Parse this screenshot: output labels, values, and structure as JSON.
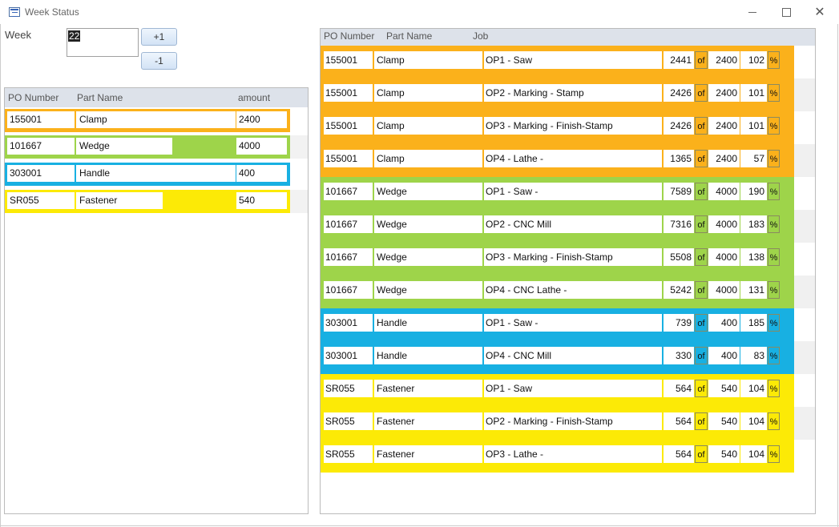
{
  "window": {
    "title": "Week Status"
  },
  "colors": {
    "orange": "#fbb11b",
    "green": "#9ed44a",
    "blue": "#18b0e2",
    "yellow": "#fcea06"
  },
  "week": {
    "label": "Week",
    "value": "22",
    "plus_label": "+1",
    "minus_label": "-1"
  },
  "left_table": {
    "headers": {
      "po": "PO Number",
      "part": "Part Name",
      "amount": "amount"
    },
    "rows": [
      {
        "po": "155001",
        "part": "Clamp",
        "amount": "2400",
        "color": "orange"
      },
      {
        "po": "101667",
        "part": "Wedge",
        "amount": "4000",
        "color": "green"
      },
      {
        "po": "303001",
        "part": "Handle",
        "amount": "400",
        "color": "blue"
      },
      {
        "po": "SR055",
        "part": "Fastener",
        "amount": "540",
        "color": "yellow"
      }
    ]
  },
  "right_table": {
    "headers": {
      "po": "PO Number",
      "part": "Part Name",
      "job": "Job"
    },
    "of_label": "of",
    "pct_label": "%",
    "rows": [
      {
        "po": "155001",
        "part": "Clamp",
        "job": "OP1 - Saw",
        "count": "2441",
        "total": "2400",
        "pct": "102",
        "color": "orange"
      },
      {
        "po": "155001",
        "part": "Clamp",
        "job": "OP2 - Marking - Stamp",
        "count": "2426",
        "total": "2400",
        "pct": "101",
        "color": "orange"
      },
      {
        "po": "155001",
        "part": "Clamp",
        "job": "OP3 - Marking - Finish-Stamp",
        "count": "2426",
        "total": "2400",
        "pct": "101",
        "color": "orange"
      },
      {
        "po": "155001",
        "part": "Clamp",
        "job": "OP4 - Lathe -",
        "count": "1365",
        "total": "2400",
        "pct": "57",
        "color": "orange"
      },
      {
        "po": "101667",
        "part": "Wedge",
        "job": "OP1 - Saw -",
        "count": "7589",
        "total": "4000",
        "pct": "190",
        "color": "green"
      },
      {
        "po": "101667",
        "part": "Wedge",
        "job": "OP2 - CNC Mill",
        "count": "7316",
        "total": "4000",
        "pct": "183",
        "color": "green"
      },
      {
        "po": "101667",
        "part": "Wedge",
        "job": "OP3 - Marking - Finish-Stamp",
        "count": "5508",
        "total": "4000",
        "pct": "138",
        "color": "green"
      },
      {
        "po": "101667",
        "part": "Wedge",
        "job": "OP4 - CNC Lathe -",
        "count": "5242",
        "total": "4000",
        "pct": "131",
        "color": "green"
      },
      {
        "po": "303001",
        "part": "Handle",
        "job": "OP1 - Saw -",
        "count": "739",
        "total": "400",
        "pct": "185",
        "color": "blue"
      },
      {
        "po": "303001",
        "part": "Handle",
        "job": "OP4 - CNC Mill",
        "count": "330",
        "total": "400",
        "pct": "83",
        "color": "blue"
      },
      {
        "po": "SR055",
        "part": "Fastener",
        "job": "OP1 - Saw",
        "count": "564",
        "total": "540",
        "pct": "104",
        "color": "yellow"
      },
      {
        "po": "SR055",
        "part": "Fastener",
        "job": "OP2 - Marking - Finish-Stamp",
        "count": "564",
        "total": "540",
        "pct": "104",
        "color": "yellow"
      },
      {
        "po": "SR055",
        "part": "Fastener",
        "job": "OP3 - Lathe -",
        "count": "564",
        "total": "540",
        "pct": "104",
        "color": "yellow"
      }
    ]
  }
}
